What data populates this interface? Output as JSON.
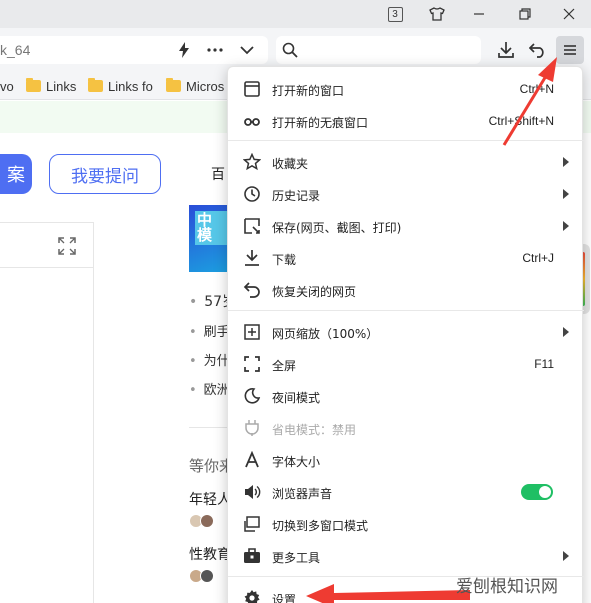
{
  "titlebar": {
    "tab_count": "3"
  },
  "addressbar": {
    "url": "k_64"
  },
  "bookmarks": [
    {
      "label": "vo",
      "folder": false
    },
    {
      "label": "Links",
      "folder": true
    },
    {
      "label": "Links fo",
      "folder": true
    },
    {
      "label": "Micros",
      "folder": true
    }
  ],
  "page": {
    "search_button": "案",
    "ask_button": "我要提问",
    "baidu_text": "百",
    "banner_text": "中\n模",
    "bullets": [
      "57岁",
      "刷手",
      "为什",
      "欧洲"
    ],
    "section_title": "等你来",
    "questions": [
      "年轻人",
      "性教育"
    ]
  },
  "menu": {
    "items": [
      {
        "label": "打开新的窗口",
        "shortcut": "Ctrl+N",
        "icon": "new-window-icon"
      },
      {
        "label": "打开新的无痕窗口",
        "shortcut": "Ctrl+Shift+N",
        "icon": "incognito-icon"
      },
      {
        "label": "收藏夹",
        "icon": "bookmark-star-icon",
        "submenu": true
      },
      {
        "label": "历史记录",
        "icon": "history-clock-icon",
        "submenu": true
      },
      {
        "label": "保存(网页、截图、打印)",
        "icon": "save-page-icon",
        "submenu": true
      },
      {
        "label": "下载",
        "shortcut": "Ctrl+J",
        "icon": "download-icon"
      },
      {
        "label": "恢复关闭的网页",
        "icon": "restore-icon"
      },
      {
        "label": "网页缩放（100%）",
        "icon": "zoom-icon",
        "submenu": true
      },
      {
        "label": "全屏",
        "shortcut": "F11",
        "icon": "fullscreen-icon"
      },
      {
        "label": "夜间模式",
        "icon": "moon-icon"
      },
      {
        "label": "省电模式：禁用",
        "icon": "power-plug-icon",
        "disabled": true
      },
      {
        "label": "字体大小",
        "icon": "font-size-icon"
      },
      {
        "label": "浏览器声音",
        "icon": "speaker-icon",
        "toggle": true
      },
      {
        "label": "切换到多窗口模式",
        "icon": "multi-window-icon"
      },
      {
        "label": "更多工具",
        "icon": "toolbox-icon",
        "submenu": true
      },
      {
        "label": "设置",
        "icon": "gear-icon"
      }
    ]
  },
  "watermark": "爱刨根知识网",
  "colors": {
    "accent": "#4e6ef2",
    "toggle_on": "#1fbf64",
    "arrow": "#ee3b32"
  }
}
